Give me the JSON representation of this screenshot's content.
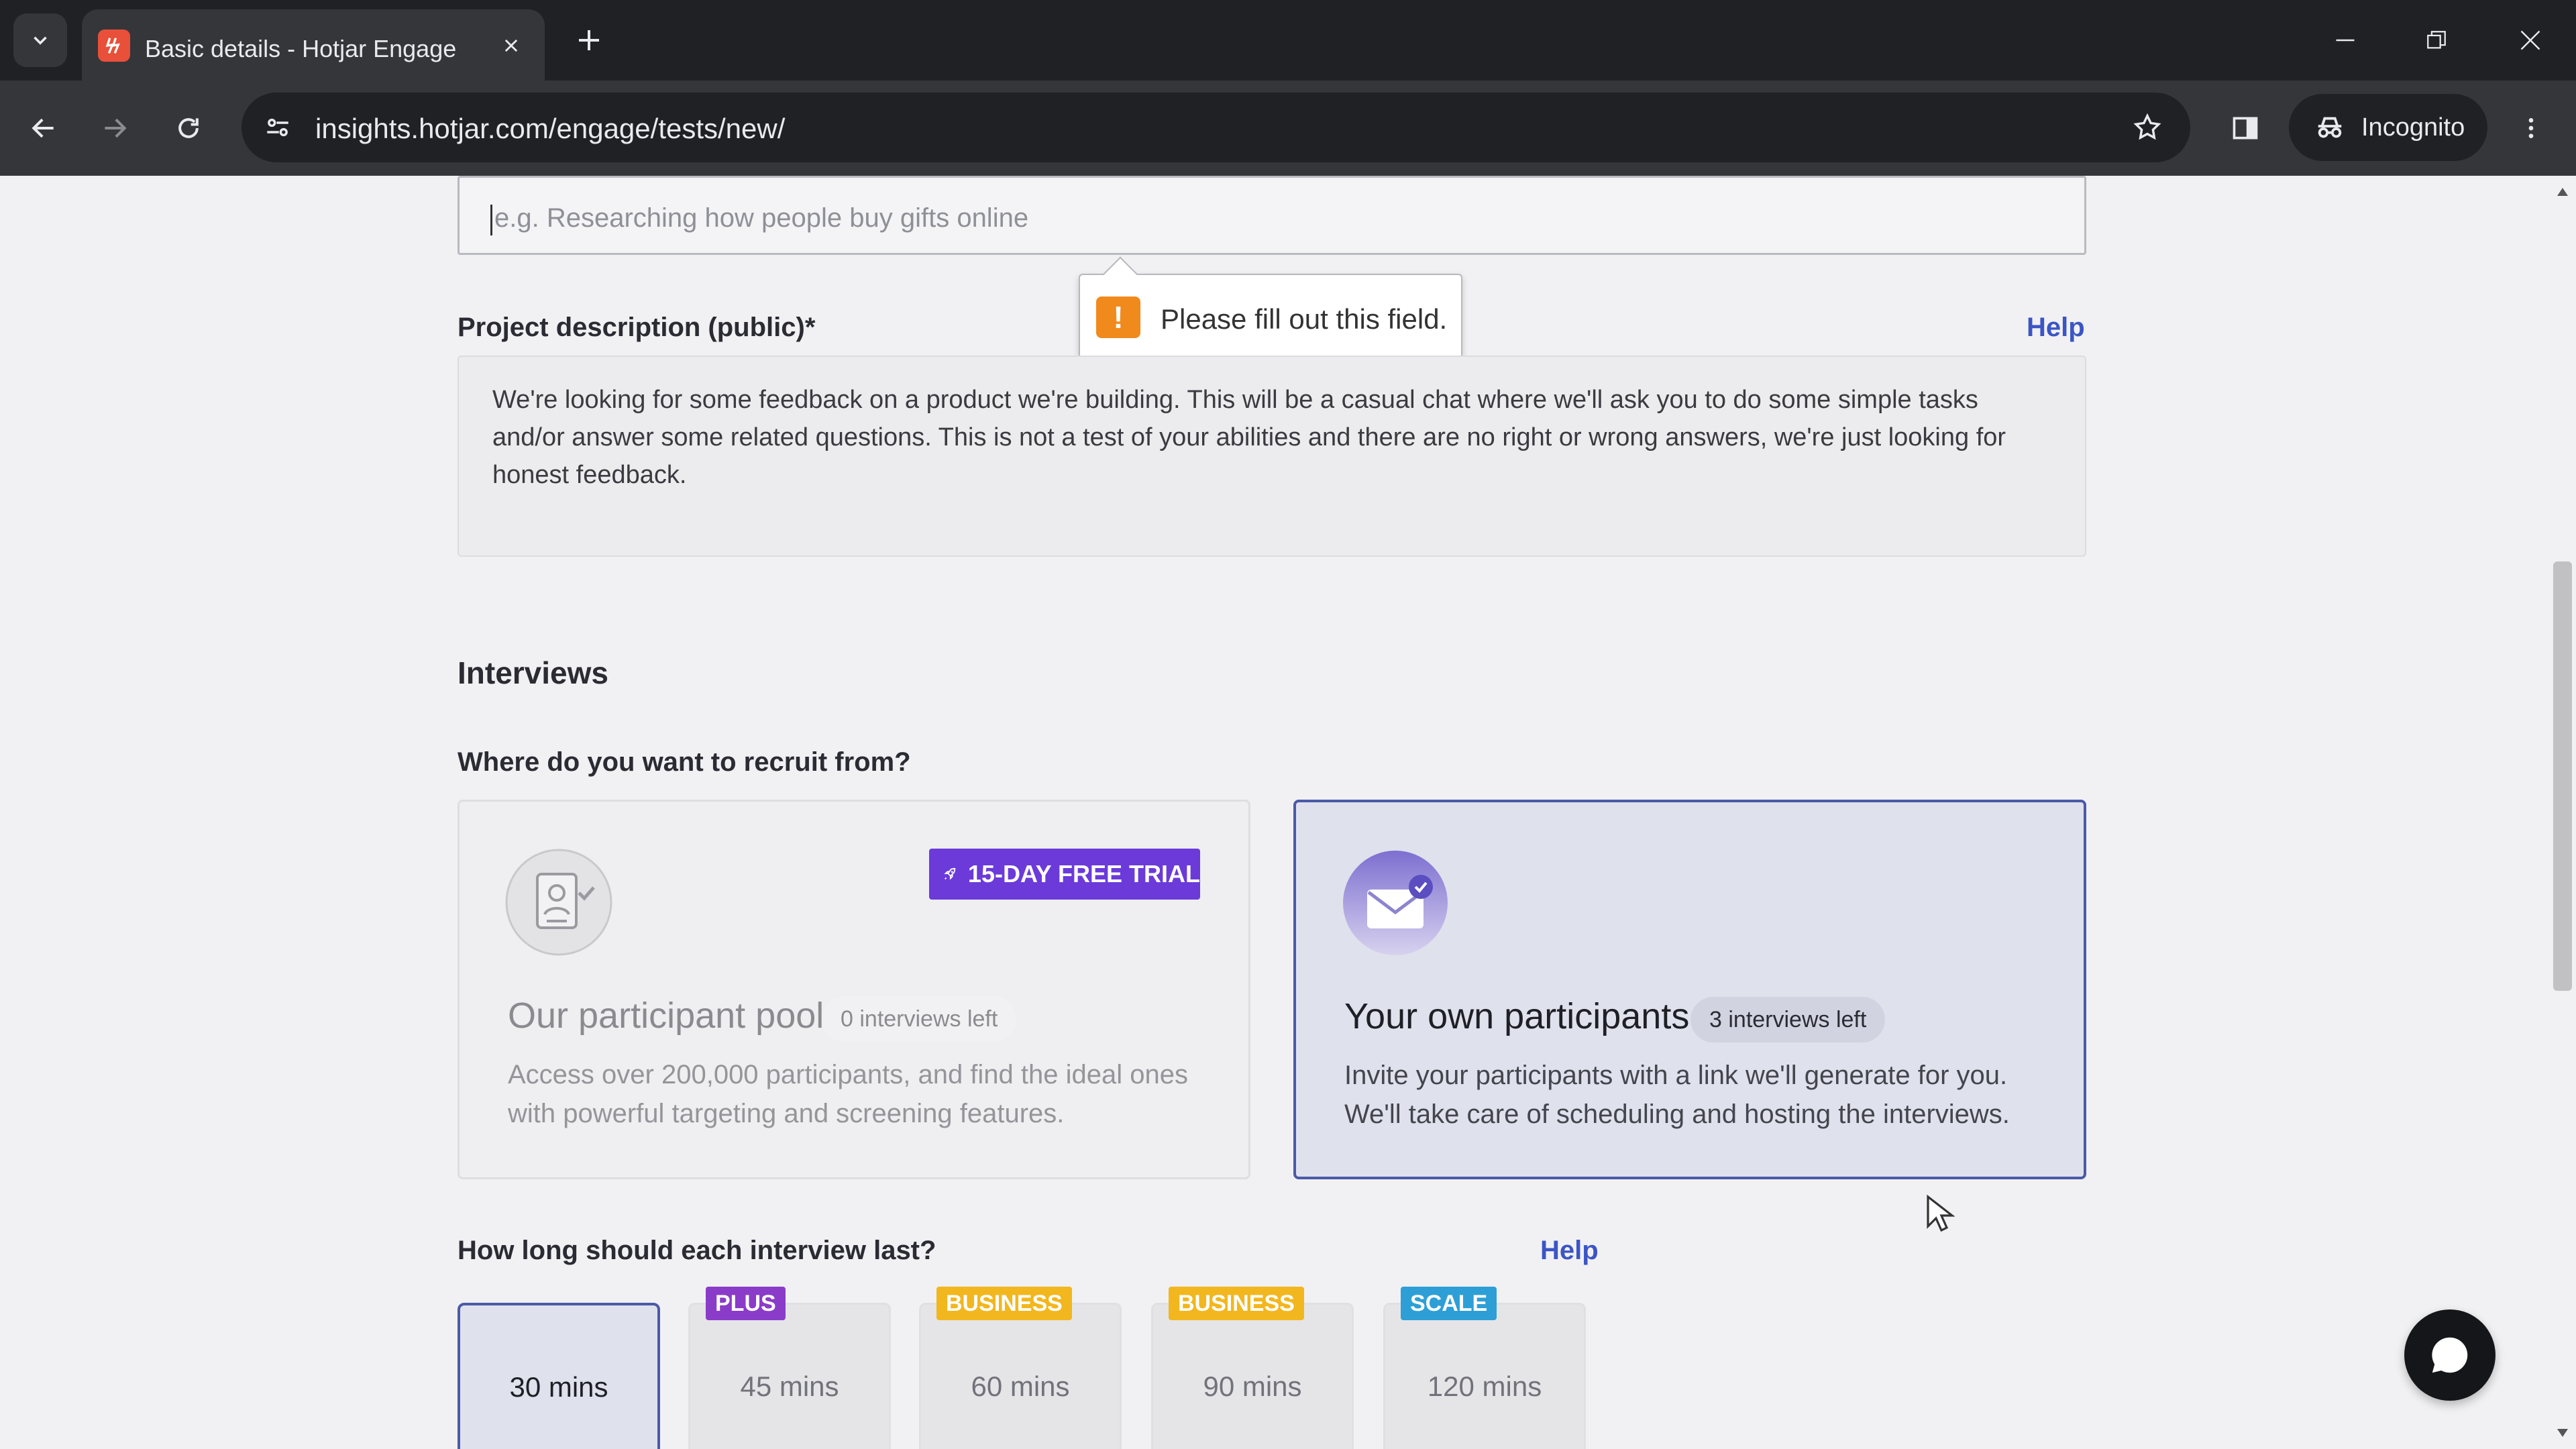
{
  "browser": {
    "tab_title": "Basic details - Hotjar Engage",
    "url": "insights.hotjar.com/engage/tests/new/",
    "incognito_label": "Incognito"
  },
  "form": {
    "title_placeholder": "e.g. Researching how people buy gifts online",
    "validation_message": "Please fill out this field.",
    "description_label": "Project description (public)*",
    "description_help": "Help",
    "description_text": "We're looking for some feedback on a product we're building. This will be a casual chat where we'll ask you to do some simple tasks and/or answer some related questions. This is not a test of your abilities and there are no right or wrong answers, we're just looking for honest feedback."
  },
  "interviews": {
    "section_title": "Interviews",
    "recruit_question": "Where do you want to recruit from?",
    "options": [
      {
        "title": "Our participant pool",
        "badge": "0 interviews left",
        "trial_badge": "15-DAY FREE TRIAL",
        "description": "Access over 200,000 participants, and find the ideal ones with powerful targeting and screening features.",
        "selected": false
      },
      {
        "title": "Your own participants",
        "badge": "3 interviews left",
        "description": "Invite your participants with a link we'll generate for you. We'll take care of scheduling and hosting the interviews.",
        "selected": true
      }
    ],
    "duration_question": "How long should each interview last?",
    "duration_help": "Help",
    "durations": [
      {
        "label": "30 mins",
        "tier": "",
        "selected": true
      },
      {
        "label": "45 mins",
        "tier": "PLUS",
        "selected": false
      },
      {
        "label": "60 mins",
        "tier": "BUSINESS",
        "selected": false
      },
      {
        "label": "90 mins",
        "tier": "BUSINESS",
        "selected": false
      },
      {
        "label": "120 mins",
        "tier": "SCALE",
        "selected": false
      }
    ]
  },
  "colors": {
    "accent": "#4b5aa8",
    "help_link": "#3b55c4",
    "trial_purple": "#6b3ad9",
    "plus": "#8a3cc8",
    "business": "#f2b71e",
    "scale": "#2e9fd6",
    "warning": "#f08a1d"
  }
}
